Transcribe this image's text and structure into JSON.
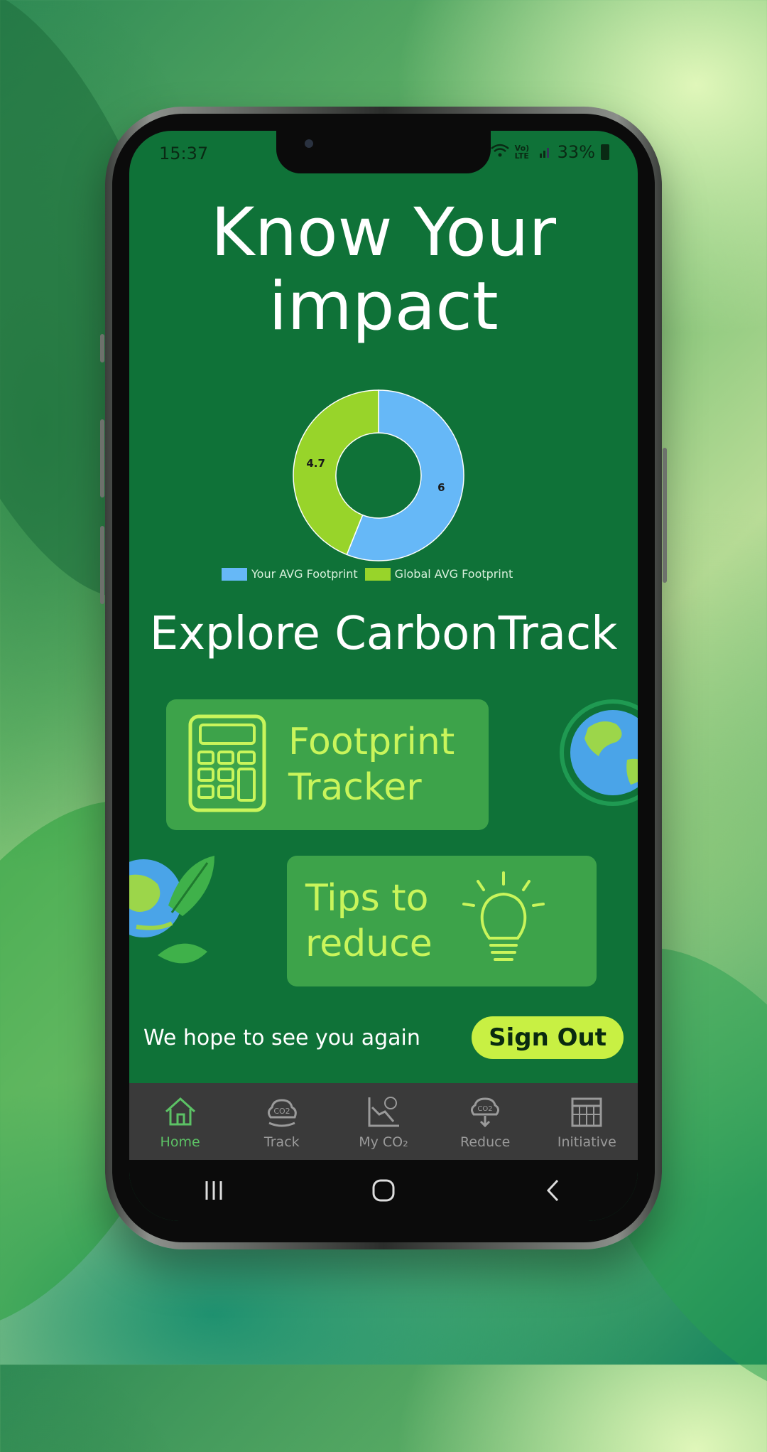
{
  "status_bar": {
    "time": "15:37",
    "signal": "Vo) LTE",
    "battery": "33%"
  },
  "header": {
    "title_line1": "Know Your",
    "title_line2": "impact"
  },
  "chart_data": {
    "type": "pie",
    "categories": [
      "Your AVG Footprint",
      "Global AVG Footprint"
    ],
    "values": [
      6,
      4.7
    ],
    "colors": [
      "#66b8f7",
      "#98d42a"
    ],
    "legend_position": "bottom"
  },
  "explore": {
    "title": "Explore CarbonTrack"
  },
  "cards": {
    "footprint_line1": "Footprint",
    "footprint_line2": "Tracker",
    "tips_line1": "Tips to",
    "tips_line2": "reduce"
  },
  "footer": {
    "message": "We hope to see you again",
    "signout_label": "Sign Out"
  },
  "tabbar": {
    "tabs": [
      {
        "label": "Home",
        "icon": "home-icon",
        "active": true
      },
      {
        "label": "Track",
        "icon": "co2-cloud-icon",
        "active": false
      },
      {
        "label": "My CO₂",
        "icon": "co2-chart-icon",
        "active": false
      },
      {
        "label": "Reduce",
        "icon": "co2-reduce-icon",
        "active": false
      },
      {
        "label": "Initiative",
        "icon": "calendar-icon",
        "active": false
      }
    ]
  },
  "colors": {
    "screen_bg": "#0f7238",
    "card_bg": "#3da34a",
    "card_text": "#c9f55b",
    "signout_bg": "#c8f043",
    "tab_active": "#5cc265"
  }
}
